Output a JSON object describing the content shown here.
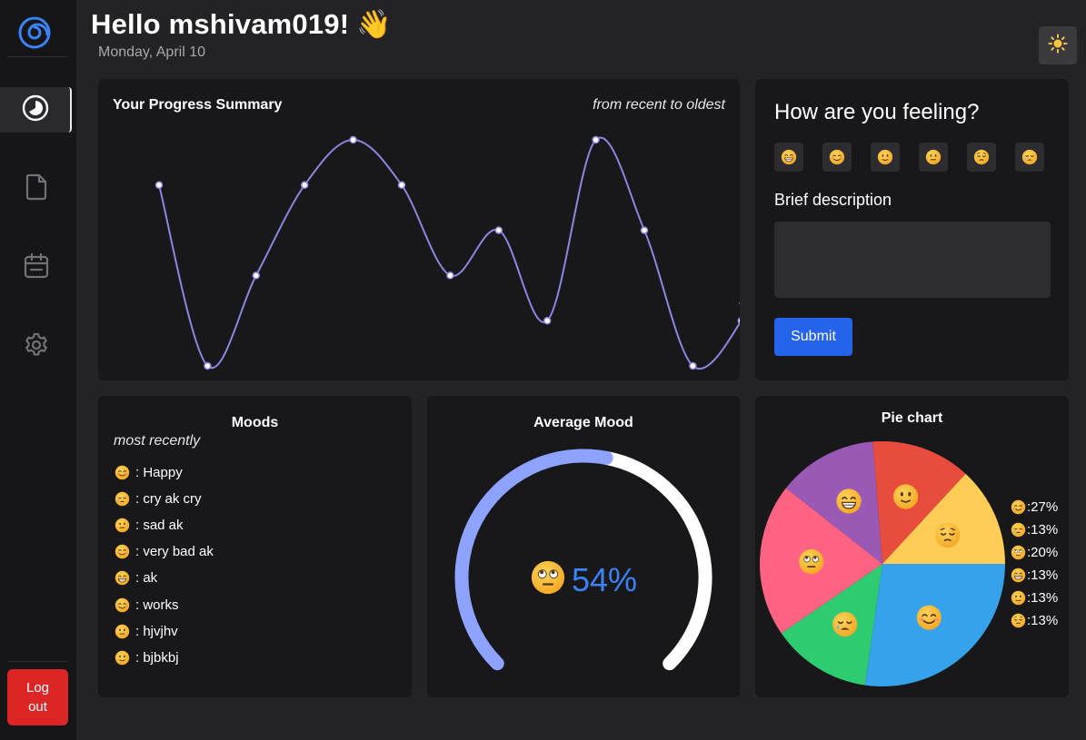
{
  "header": {
    "greeting": "Hello mshivam019!",
    "wave_emoji": "👋",
    "date": "Monday, April 10"
  },
  "sidebar": {
    "items": [
      {
        "icon": "dashboard-icon",
        "active": true
      },
      {
        "icon": "document-icon",
        "active": false
      },
      {
        "icon": "calendar-icon",
        "active": false
      },
      {
        "icon": "gear-icon",
        "active": false
      }
    ],
    "logout_label": "Log\nout"
  },
  "progress": {
    "title": "Your Progress Summary",
    "subtitle": "from recent to oldest"
  },
  "feeling": {
    "title": "How are you feeling?",
    "options": [
      "grinning",
      "smiling",
      "slight-smile",
      "neutral",
      "pensive",
      "crying"
    ],
    "desc_label": "Brief description",
    "desc_value": "",
    "submit_label": "Submit"
  },
  "moods": {
    "title": "Moods",
    "subtitle": "most recently",
    "items": [
      {
        "face": "smiling",
        "text": ": Happy"
      },
      {
        "face": "crying",
        "text": ": cry ak cry"
      },
      {
        "face": "neutral",
        "text": ": sad ak"
      },
      {
        "face": "smiling",
        "text": ": very bad ak"
      },
      {
        "face": "grinning",
        "text": ": ak"
      },
      {
        "face": "smiling",
        "text": ": works"
      },
      {
        "face": "neutral",
        "text": ": hjvjhv"
      },
      {
        "face": "slight-smile",
        "text": ": bjbkbj"
      }
    ]
  },
  "average": {
    "title": "Average Mood",
    "value_text": "54%",
    "value": 54,
    "face": "rolling-eyes"
  },
  "pie": {
    "title": "Pie chart",
    "legend": [
      {
        "face": "smiling",
        "text": ":27%"
      },
      {
        "face": "crying",
        "text": ":13%"
      },
      {
        "face": "rolling-eyes",
        "text": ":20%"
      },
      {
        "face": "grinning",
        "text": ":13%"
      },
      {
        "face": "slight-smile",
        "text": ":13%"
      },
      {
        "face": "pensive",
        "text": ":13%"
      }
    ]
  },
  "colors": {
    "accent": "#2563eb",
    "line": "#8b86e0",
    "gauge": "#8ea2ff",
    "logout": "#dc2626",
    "pie": [
      "#36a2eb",
      "#2ecc71",
      "#ff6384",
      "#9b59b6",
      "#e74c3c",
      "#ffcd56"
    ]
  },
  "chart_data": {
    "type": "pie",
    "title": "Pie chart",
    "slices": [
      {
        "label": "smiling",
        "value": 27,
        "color": "#36a2eb"
      },
      {
        "label": "crying",
        "value": 13,
        "color": "#2ecc71"
      },
      {
        "label": "rolling-eyes",
        "value": 20,
        "color": "#ff6384"
      },
      {
        "label": "grinning",
        "value": 13,
        "color": "#9b59b6"
      },
      {
        "label": "slight-smile",
        "value": 13,
        "color": "#e74c3c"
      },
      {
        "label": "pensive",
        "value": 13,
        "color": "#ffcd56"
      }
    ],
    "progress_line": {
      "type": "line",
      "title": "Your Progress Summary",
      "values": [
        4,
        0,
        2,
        4,
        5,
        4,
        2,
        3,
        1,
        5,
        3,
        0,
        1
      ],
      "ylim": [
        0,
        5
      ]
    }
  }
}
